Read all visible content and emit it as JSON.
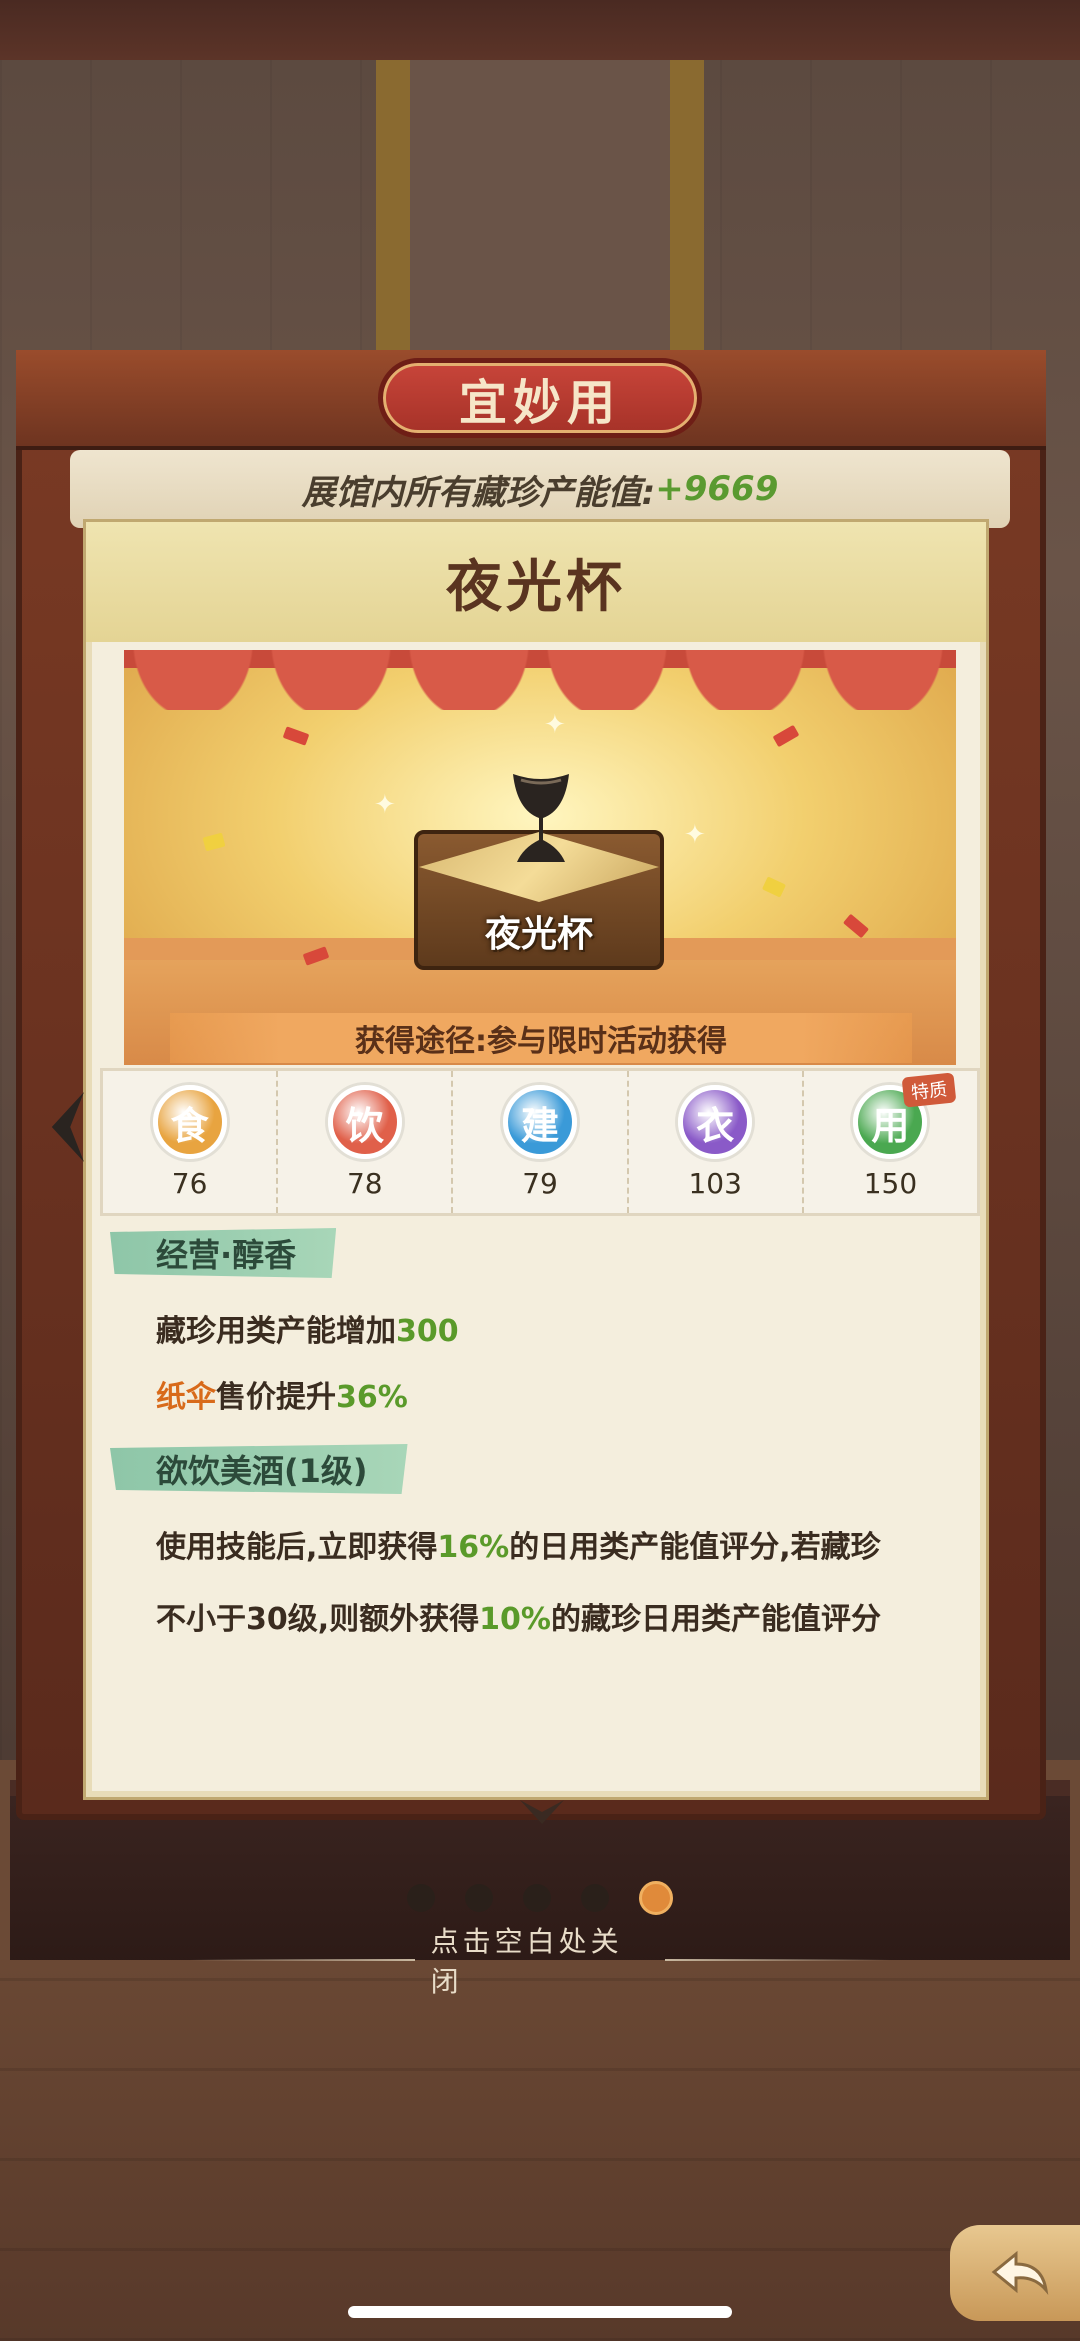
{
  "category_title": "宜妙用",
  "total_stat": {
    "label": "展馆内所有藏珍产能值:",
    "value": "+9669"
  },
  "item": {
    "title": "夜光杯",
    "stage_name": "夜光杯",
    "source": "获得途径:参与限时活动获得"
  },
  "attributes": [
    {
      "char": "食",
      "value": "76",
      "color": "#e8a440"
    },
    {
      "char": "饮",
      "value": "78",
      "color": "#e0604a"
    },
    {
      "char": "建",
      "value": "79",
      "color": "#3a9ad8"
    },
    {
      "char": "衣",
      "value": "103",
      "color": "#8a5ac8"
    },
    {
      "char": "用",
      "value": "150",
      "color": "#4aa850",
      "tag": "特质"
    }
  ],
  "skills": [
    {
      "name": "经营·醇香",
      "lines": [
        {
          "parts": [
            {
              "t": "藏珍用类产能增加",
              "c": ""
            },
            {
              "t": "300",
              "c": "green"
            }
          ]
        },
        {
          "parts": [
            {
              "t": "纸伞",
              "c": "orange"
            },
            {
              "t": "售价提升",
              "c": ""
            },
            {
              "t": "36%",
              "c": "green"
            }
          ]
        }
      ]
    },
    {
      "name": "欲饮美酒(1级)",
      "lines": [
        {
          "parts": [
            {
              "t": "使用技能后,立即获得",
              "c": ""
            },
            {
              "t": "16%",
              "c": "green"
            },
            {
              "t": "的日用类产能值评分,若藏珍",
              "c": ""
            }
          ]
        },
        {
          "parts": [
            {
              "t": "不小于30级,则额外获得",
              "c": ""
            },
            {
              "t": "10%",
              "c": "green"
            },
            {
              "t": "的藏珍日用类产能值评分",
              "c": ""
            }
          ]
        }
      ]
    }
  ],
  "pager": {
    "count": 5,
    "active": 4
  },
  "close_hint": "点击空白处关闭"
}
